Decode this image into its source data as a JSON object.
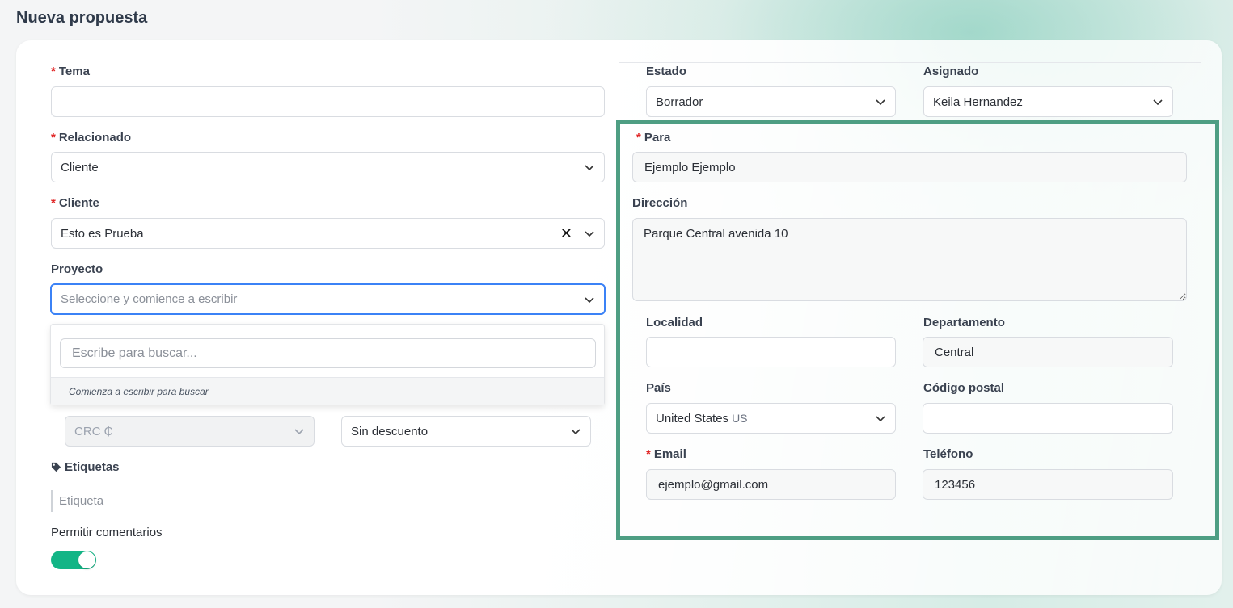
{
  "page": {
    "title": "Nueva propuesta"
  },
  "left": {
    "tema": {
      "label": "Tema",
      "value": ""
    },
    "relacionado": {
      "label": "Relacionado",
      "value": "Cliente"
    },
    "cliente": {
      "label": "Cliente",
      "value": "Esto es Prueba"
    },
    "proyecto": {
      "label": "Proyecto",
      "placeholder": "Seleccione y comience a escribir",
      "dropdown": {
        "search_placeholder": "Escribe para buscar...",
        "hint": "Comienza a escribir para buscar"
      }
    },
    "moneda": {
      "value": "CRC ₵"
    },
    "descuento": {
      "value": "Sin descuento"
    },
    "etiquetas": {
      "label": "Etiquetas",
      "placeholder": "Etiqueta"
    },
    "comentarios": {
      "label": "Permitir comentarios",
      "enabled": true
    }
  },
  "right": {
    "estado": {
      "label": "Estado",
      "value": "Borrador"
    },
    "asignado": {
      "label": "Asignado",
      "value": "Keila Hernandez"
    },
    "para": {
      "label": "Para",
      "value": "Ejemplo Ejemplo"
    },
    "direccion": {
      "label": "Dirección",
      "value": "Parque Central avenida 10"
    },
    "localidad": {
      "label": "Localidad",
      "value": ""
    },
    "departamento": {
      "label": "Departamento",
      "value": "Central"
    },
    "pais": {
      "label": "País",
      "value": "United States",
      "code": "US"
    },
    "codigo_postal": {
      "label": "Código postal",
      "value": ""
    },
    "email": {
      "label": "Email",
      "value": "ejemplo@gmail.com"
    },
    "telefono": {
      "label": "Teléfono",
      "value": "123456"
    }
  },
  "colors": {
    "highlight": "#4e9e83",
    "toggle_on": "#13b586",
    "focus": "#3b82f6",
    "required": "#e02424"
  }
}
